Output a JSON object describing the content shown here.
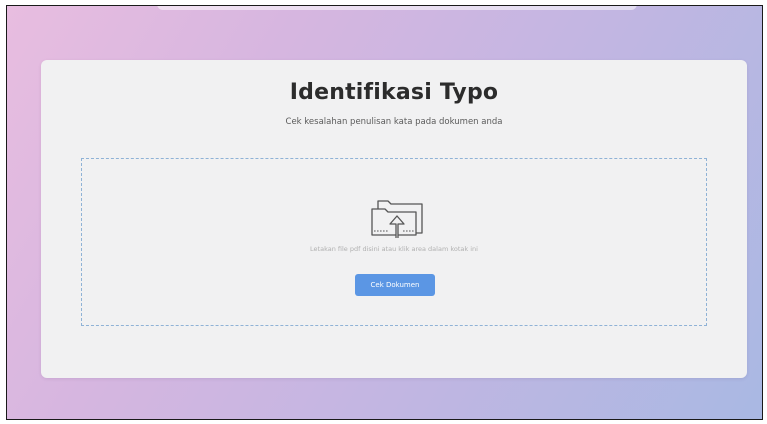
{
  "card": {
    "title": "Identifikasi Typo",
    "subtitle": "Cek kesalahan penulisan kata pada dokumen anda"
  },
  "dropzone": {
    "icon": "folder-upload-icon",
    "hint": "Letakan file pdf disini atau klik area dalam kotak ini",
    "button_label": "Cek Dokumen"
  },
  "colors": {
    "accent": "#5b96e4",
    "card_background": "#f1f1f2",
    "dropzone_border": "#8fb2d6",
    "gradient_start": "#e8bde0",
    "gradient_end": "#a9b8e3"
  }
}
